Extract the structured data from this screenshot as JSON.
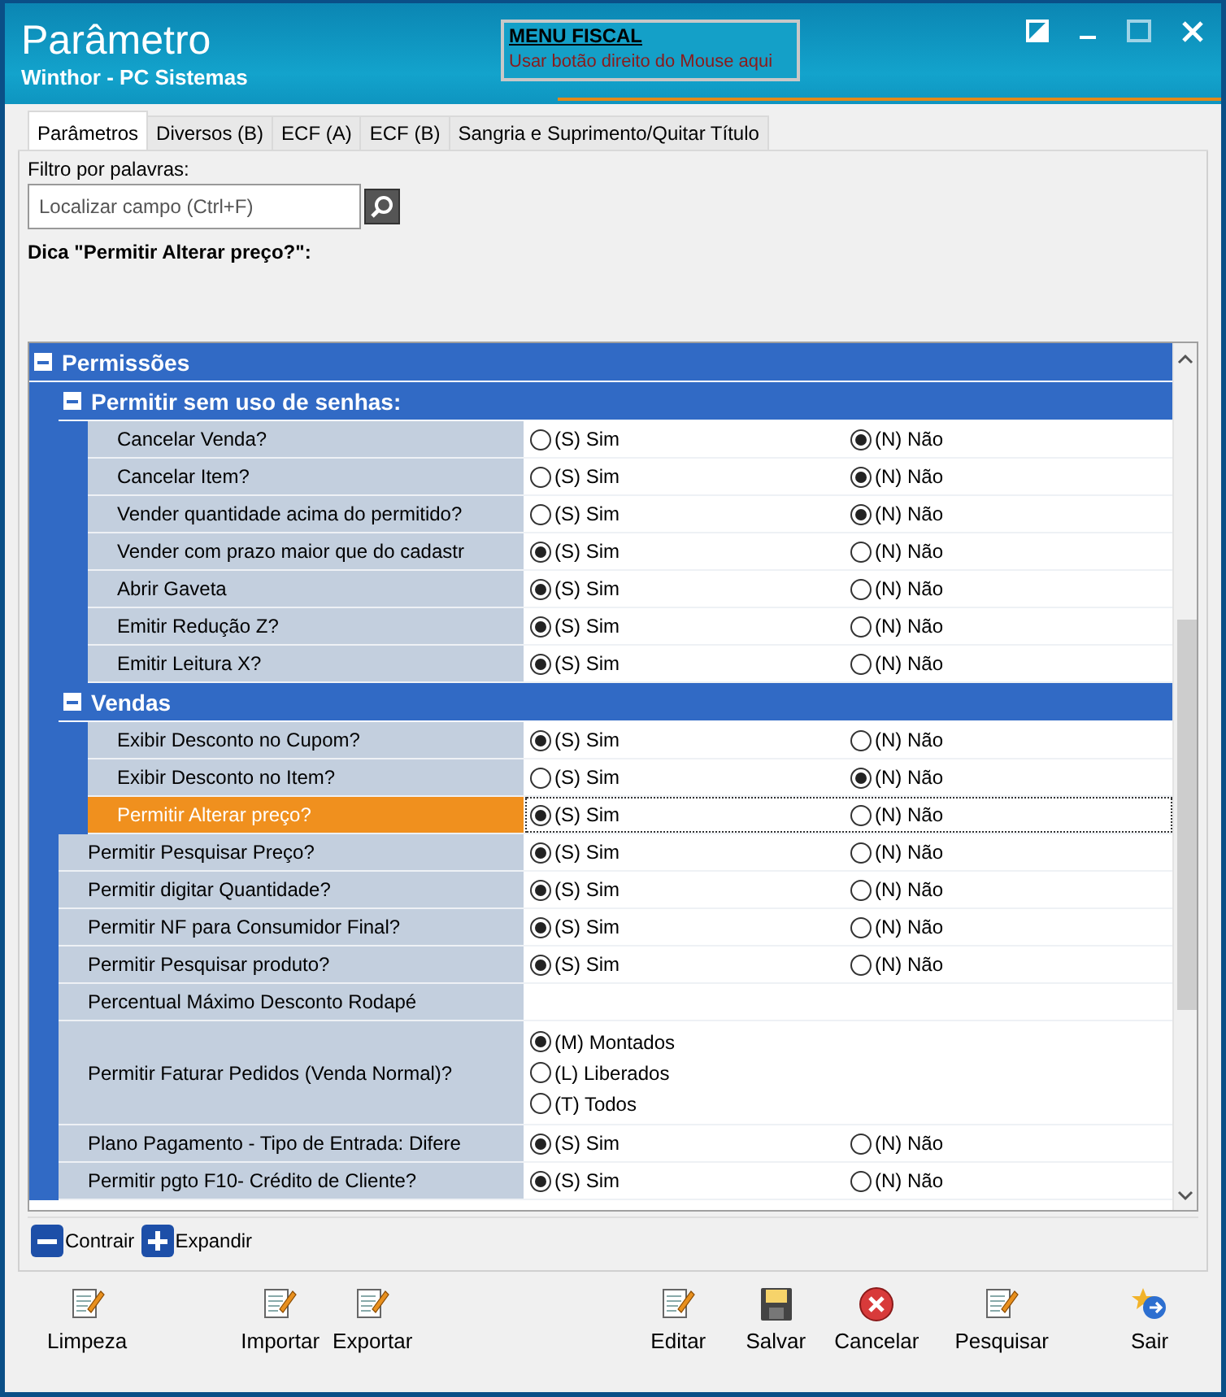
{
  "window": {
    "title": "Parâmetro",
    "subtitle": "Winthor - PC Sistemas"
  },
  "fiscal_menu": {
    "title": "MENU FISCAL",
    "hint": "Usar botão direito do Mouse aqui"
  },
  "tabs": [
    {
      "label": "Parâmetros",
      "selected": true
    },
    {
      "label": "Diversos (B)",
      "selected": false
    },
    {
      "label": "ECF (A)",
      "selected": false
    },
    {
      "label": "ECF (B)",
      "selected": false
    },
    {
      "label": "Sangria e Suprimento/Quitar Título",
      "selected": false
    }
  ],
  "filter": {
    "label": "Filtro por palavras:",
    "placeholder": "Localizar campo (Ctrl+F)"
  },
  "tip": "Dica \"Permitir Alterar preço?\":",
  "tree": [
    {
      "kind": "group",
      "label": "Permissões",
      "expanded": true,
      "children": [
        {
          "kind": "group",
          "label": "Permitir sem uso de senhas:",
          "expanded": true,
          "children": [
            {
              "kind": "choice",
              "label": "Cancelar Venda?",
              "selected": false,
              "options": [
                {
                  "label": "(S) Sim",
                  "checked": false
                },
                {
                  "label": "(N) Não",
                  "checked": true
                }
              ]
            },
            {
              "kind": "choice",
              "label": "Cancelar Item?",
              "selected": false,
              "options": [
                {
                  "label": "(S) Sim",
                  "checked": false
                },
                {
                  "label": "(N) Não",
                  "checked": true
                }
              ]
            },
            {
              "kind": "choice",
              "label": "Vender quantidade acima do permitido?",
              "selected": false,
              "options": [
                {
                  "label": "(S) Sim",
                  "checked": false
                },
                {
                  "label": "(N) Não",
                  "checked": true
                }
              ]
            },
            {
              "kind": "choice",
              "label": "Vender com prazo maior que do cadastr",
              "selected": false,
              "options": [
                {
                  "label": "(S) Sim",
                  "checked": true
                },
                {
                  "label": "(N) Não",
                  "checked": false
                }
              ]
            },
            {
              "kind": "choice",
              "label": "Abrir Gaveta",
              "selected": false,
              "options": [
                {
                  "label": "(S) Sim",
                  "checked": true
                },
                {
                  "label": "(N) Não",
                  "checked": false
                }
              ]
            },
            {
              "kind": "choice",
              "label": "Emitir Redução Z?",
              "selected": false,
              "options": [
                {
                  "label": "(S) Sim",
                  "checked": true
                },
                {
                  "label": "(N) Não",
                  "checked": false
                }
              ]
            },
            {
              "kind": "choice",
              "label": "Emitir Leitura X?",
              "selected": false,
              "options": [
                {
                  "label": "(S) Sim",
                  "checked": true
                },
                {
                  "label": "(N) Não",
                  "checked": false
                }
              ]
            }
          ]
        },
        {
          "kind": "group",
          "label": "Vendas",
          "expanded": true,
          "children": [
            {
              "kind": "choice",
              "label": "Exibir Desconto no Cupom?",
              "selected": false,
              "options": [
                {
                  "label": "(S) Sim",
                  "checked": true
                },
                {
                  "label": "(N) Não",
                  "checked": false
                }
              ]
            },
            {
              "kind": "choice",
              "label": "Exibir Desconto no Item?",
              "selected": false,
              "options": [
                {
                  "label": "(S) Sim",
                  "checked": false
                },
                {
                  "label": "(N) Não",
                  "checked": true
                }
              ]
            },
            {
              "kind": "choice",
              "label": "Permitir Alterar preço?",
              "selected": true,
              "options": [
                {
                  "label": "(S) Sim",
                  "checked": true
                },
                {
                  "label": "(N) Não",
                  "checked": false
                }
              ]
            }
          ]
        },
        {
          "kind": "choice",
          "label": "Permitir Pesquisar Preço?",
          "selected": false,
          "options": [
            {
              "label": "(S) Sim",
              "checked": true
            },
            {
              "label": "(N) Não",
              "checked": false
            }
          ]
        },
        {
          "kind": "choice",
          "label": "Permitir digitar Quantidade?",
          "selected": false,
          "options": [
            {
              "label": "(S) Sim",
              "checked": true
            },
            {
              "label": "(N) Não",
              "checked": false
            }
          ]
        },
        {
          "kind": "choice",
          "label": "Permitir NF para Consumidor Final?",
          "selected": false,
          "options": [
            {
              "label": "(S) Sim",
              "checked": true
            },
            {
              "label": "(N) Não",
              "checked": false
            }
          ]
        },
        {
          "kind": "choice",
          "label": "Permitir Pesquisar produto?",
          "selected": false,
          "options": [
            {
              "label": "(S) Sim",
              "checked": true
            },
            {
              "label": "(N) Não",
              "checked": false
            }
          ]
        },
        {
          "kind": "text",
          "label": "Percentual Máximo Desconto Rodapé",
          "selected": false
        },
        {
          "kind": "list",
          "label": "Permitir Faturar Pedidos (Venda Normal)?",
          "selected": false,
          "options": [
            {
              "label": "(M) Montados",
              "checked": true
            },
            {
              "label": "(L) Liberados",
              "checked": false
            },
            {
              "label": "(T) Todos",
              "checked": false
            }
          ]
        },
        {
          "kind": "choice",
          "label": "Plano Pagamento - Tipo de Entrada: Difere",
          "selected": false,
          "options": [
            {
              "label": "(S) Sim",
              "checked": true
            },
            {
              "label": "(N) Não",
              "checked": false
            }
          ]
        },
        {
          "kind": "choice",
          "label": "Permitir pgto F10- Crédito de Cliente?",
          "selected": false,
          "options": [
            {
              "label": "(S) Sim",
              "checked": true
            },
            {
              "label": "(N) Não",
              "checked": false
            }
          ]
        }
      ]
    }
  ],
  "tree_actions": [
    {
      "kind": "collapse",
      "label": "Contrair"
    },
    {
      "kind": "expand",
      "label": "Expandir"
    }
  ],
  "toolbar": [
    {
      "kind": "note",
      "label": "Limpeza"
    },
    {
      "kind": "note",
      "label": "Importar"
    },
    {
      "kind": "note",
      "label": "Exportar"
    },
    {
      "kind": "note",
      "label": "Editar"
    },
    {
      "kind": "save",
      "label": "Salvar"
    },
    {
      "kind": "cancel",
      "label": "Cancelar"
    },
    {
      "kind": "note",
      "label": "Pesquisar"
    },
    {
      "kind": "exit",
      "label": "Sair"
    }
  ]
}
